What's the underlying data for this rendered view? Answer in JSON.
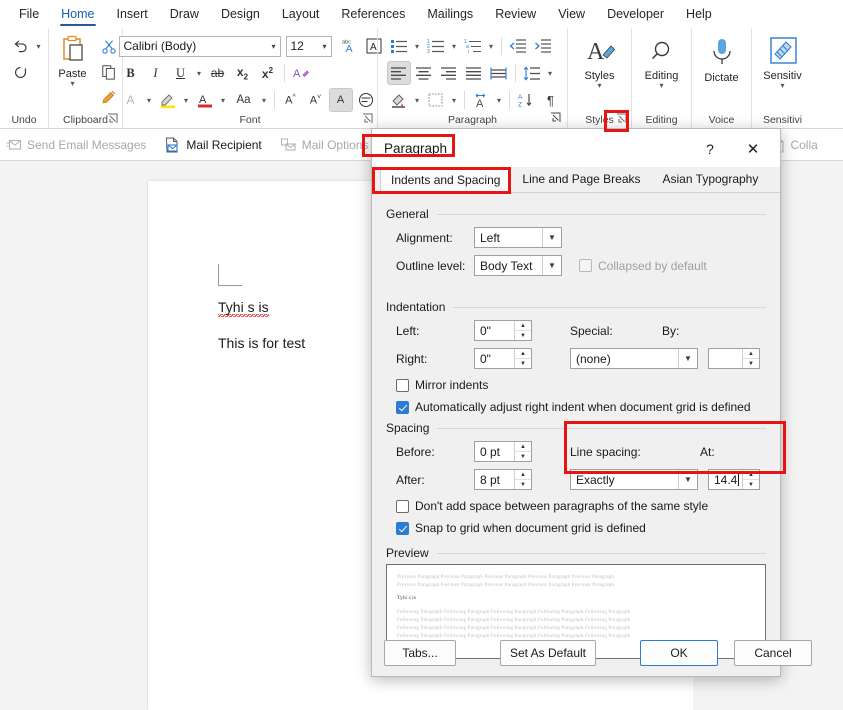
{
  "app": {
    "name": "Microsoft Word"
  },
  "ribbon_tabs": [
    {
      "label": "File",
      "active": false
    },
    {
      "label": "Home",
      "active": true
    },
    {
      "label": "Insert",
      "active": false
    },
    {
      "label": "Draw",
      "active": false
    },
    {
      "label": "Design",
      "active": false
    },
    {
      "label": "Layout",
      "active": false
    },
    {
      "label": "References",
      "active": false
    },
    {
      "label": "Mailings",
      "active": false
    },
    {
      "label": "Review",
      "active": false
    },
    {
      "label": "View",
      "active": false
    },
    {
      "label": "Developer",
      "active": false
    },
    {
      "label": "Help",
      "active": false
    }
  ],
  "ribbon": {
    "groups": {
      "undo": {
        "label": "Undo"
      },
      "clipboard": {
        "label": "Clipboard",
        "paste_label": "Paste"
      },
      "font": {
        "label": "Font",
        "font_name": "Calibri (Body)",
        "font_size": "12"
      },
      "paragraph": {
        "label": "Paragraph"
      },
      "styles": {
        "label": "Styles",
        "button_label": "Styles"
      },
      "editing": {
        "label": "Editing",
        "button_label": "Editing"
      },
      "voice": {
        "label": "Voice",
        "button_label": "Dictate"
      },
      "sensitivity": {
        "label": "Sensitivi",
        "button_label": "Sensitiv"
      }
    }
  },
  "mail_bar": {
    "items": [
      {
        "label": "Send Email Messages",
        "enabled": false,
        "icon": "send-email-icon"
      },
      {
        "label": "Mail Recipient",
        "enabled": true,
        "icon": "mail-recipient-icon"
      },
      {
        "label": "Mail Options",
        "enabled": false,
        "icon": "mail-options-icon"
      },
      {
        "label": "Colla",
        "enabled": false,
        "icon": "collapse-doc-icon"
      }
    ]
  },
  "document": {
    "line1": "Tyhi s is",
    "line2": "This is for test"
  },
  "dialog": {
    "title": "Paragraph",
    "help_icon": "?",
    "close_icon": "✕",
    "tabs": [
      {
        "label": "Indents and Spacing",
        "active": true
      },
      {
        "label": "Line and Page Breaks",
        "active": false
      },
      {
        "label": "Asian Typography",
        "active": false
      }
    ],
    "general": {
      "section_label": "General",
      "alignment_label": "Alignment:",
      "alignment_value": "Left",
      "outline_label": "Outline level:",
      "outline_value": "Body Text",
      "collapsed_label": "Collapsed by default",
      "collapsed_checked": false,
      "collapsed_enabled": false
    },
    "indentation": {
      "section_label": "Indentation",
      "left_label": "Left:",
      "left_value": "0\"",
      "right_label": "Right:",
      "right_value": "0\"",
      "special_label": "Special:",
      "special_value": "(none)",
      "by_label": "By:",
      "by_value": "",
      "mirror_label": "Mirror indents",
      "mirror_checked": false,
      "auto_adjust_label": "Automatically adjust right indent when document grid is defined",
      "auto_adjust_checked": true
    },
    "spacing": {
      "section_label": "Spacing",
      "before_label": "Before:",
      "before_value": "0 pt",
      "after_label": "After:",
      "after_value": "8 pt",
      "line_spacing_label": "Line spacing:",
      "line_spacing_value": "Exactly",
      "at_label": "At:",
      "at_value": "14.4",
      "dont_add_label": "Don't add space between paragraphs of the same style",
      "dont_add_checked": false,
      "snap_grid_label": "Snap to grid when document grid is defined",
      "snap_grid_checked": true
    },
    "preview": {
      "section_label": "Preview",
      "previous_line": "Previous Paragraph Previous Paragraph Previous Paragraph Previous Paragraph Previous Paragraph",
      "current_line": "Tyhi s is",
      "following_line": "Following Paragraph Following Paragraph Following Paragraph Following Paragraph Following Paragraph"
    },
    "buttons": {
      "tabs": "Tabs...",
      "set_as_default": "Set As Default",
      "ok": "OK",
      "cancel": "Cancel"
    }
  },
  "annotations": {
    "color": "#e81313",
    "boxes": [
      {
        "name": "paragraph-launcher-highlight"
      },
      {
        "name": "dialog-title-highlight"
      },
      {
        "name": "indents-spacing-tab-highlight"
      },
      {
        "name": "line-spacing-highlight"
      }
    ]
  }
}
